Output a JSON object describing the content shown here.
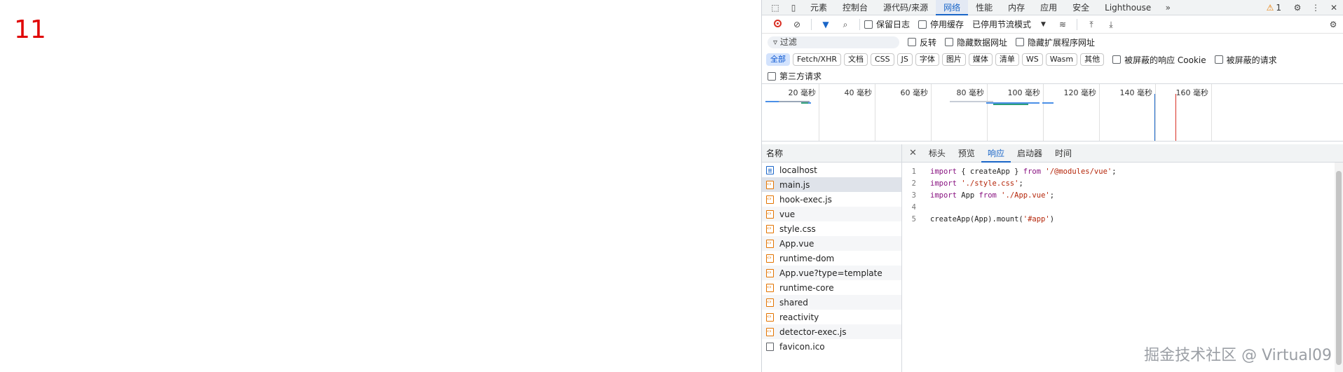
{
  "page": {
    "number": "11"
  },
  "devtools": {
    "tabs": [
      "元素",
      "控制台",
      "源代码/来源",
      "网络",
      "性能",
      "内存",
      "应用",
      "安全",
      "Lighthouse"
    ],
    "active_tab": "网络",
    "warning_count": "1",
    "toolbar": {
      "preserve_log": "保留日志",
      "disable_cache": "停用缓存",
      "throttle": "已停用节流模式"
    },
    "filter": {
      "placeholder": "过滤",
      "invert": "反转",
      "hide_data_urls": "隐藏数据网址",
      "hide_ext_urls": "隐藏扩展程序网址"
    },
    "types": [
      "全部",
      "Fetch/XHR",
      "文档",
      "CSS",
      "JS",
      "字体",
      "图片",
      "媒体",
      "清单",
      "WS",
      "Wasm",
      "其他"
    ],
    "active_type": "全部",
    "blocked_cookies": "被屏蔽的响应 Cookie",
    "blocked_requests": "被屏蔽的请求",
    "third_party": "第三方请求",
    "timeline_ticks": [
      "20 毫秒",
      "40 毫秒",
      "60 毫秒",
      "80 毫秒",
      "100 毫秒",
      "120 毫秒",
      "140 毫秒",
      "160 毫秒"
    ],
    "names_header": "名称",
    "requests": [
      {
        "name": "localhost",
        "icon": "document-icon"
      },
      {
        "name": "main.js",
        "icon": "script-icon"
      },
      {
        "name": "hook-exec.js",
        "icon": "script-icon"
      },
      {
        "name": "vue",
        "icon": "script-icon"
      },
      {
        "name": "style.css",
        "icon": "script-icon"
      },
      {
        "name": "App.vue",
        "icon": "script-icon"
      },
      {
        "name": "runtime-dom",
        "icon": "script-icon"
      },
      {
        "name": "App.vue?type=template",
        "icon": "script-icon"
      },
      {
        "name": "runtime-core",
        "icon": "script-icon"
      },
      {
        "name": "shared",
        "icon": "script-icon"
      },
      {
        "name": "reactivity",
        "icon": "script-icon"
      },
      {
        "name": "detector-exec.js",
        "icon": "script-icon"
      },
      {
        "name": "favicon.ico",
        "icon": "file-icon"
      }
    ],
    "selected_request": "main.js",
    "detail_tabs": [
      "标头",
      "预览",
      "响应",
      "启动器",
      "时间"
    ],
    "active_detail_tab": "响应",
    "code_lines": [
      {
        "n": "1",
        "tokens": [
          [
            "kw",
            "import"
          ],
          [
            "t",
            " { createApp } "
          ],
          [
            "kw",
            "from"
          ],
          [
            "t",
            " "
          ],
          [
            "str",
            "'/@modules/vue'"
          ],
          [
            "t",
            ";"
          ]
        ]
      },
      {
        "n": "2",
        "tokens": [
          [
            "kw",
            "import"
          ],
          [
            "t",
            " "
          ],
          [
            "str",
            "'./style.css'"
          ],
          [
            "t",
            ";"
          ]
        ]
      },
      {
        "n": "3",
        "tokens": [
          [
            "kw",
            "import"
          ],
          [
            "t",
            " App "
          ],
          [
            "kw",
            "from"
          ],
          [
            "t",
            " "
          ],
          [
            "str",
            "'./App.vue'"
          ],
          [
            "t",
            ";"
          ]
        ]
      },
      {
        "n": "4",
        "tokens": []
      },
      {
        "n": "5",
        "tokens": [
          [
            "t",
            "createApp(App).mount("
          ],
          [
            "str",
            "'#app'"
          ],
          [
            "t",
            ")"
          ]
        ]
      }
    ]
  },
  "watermark": "掘金技术社区 @ Virtual09",
  "colors": {
    "accent": "#1a66c8",
    "record": "#d93025",
    "warning": "#e87b00",
    "big_number": "#e00000"
  }
}
